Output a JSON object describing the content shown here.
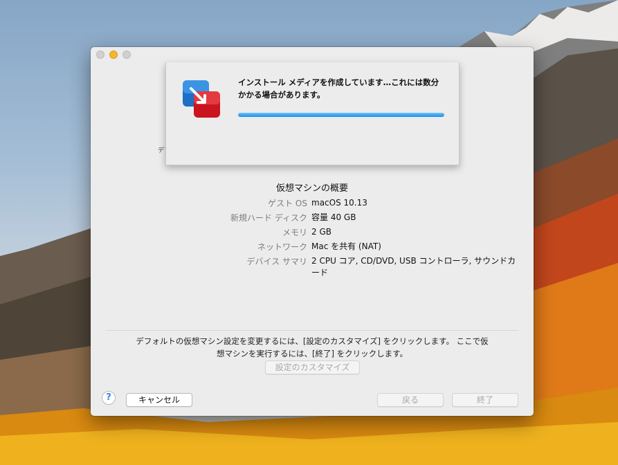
{
  "window": {
    "background_note": "",
    "ghost_label": "デフ"
  },
  "progress_sheet": {
    "message": "インストール メディアを作成しています…これには数分かかる場合があります。",
    "progress_fraction": 1.0,
    "accent_color": "#1e8ee8"
  },
  "summary": {
    "title": "仮想マシンの概要",
    "rows": [
      {
        "key": "ゲスト OS",
        "value": "macOS 10.13"
      },
      {
        "key": "新規ハード ディスク",
        "value": "容量 40 GB"
      },
      {
        "key": "メモリ",
        "value": "2 GB"
      },
      {
        "key": "ネットワーク",
        "value": "Mac を共有 (NAT)"
      },
      {
        "key": "デバイス サマリ",
        "value": "2 CPU コア, CD/DVD, USB コントローラ, サウンドカード"
      }
    ]
  },
  "note": {
    "line1": "デフォルトの仮想マシン設定を変更するには、[設定のカスタマイズ] をクリックします。 ここで仮",
    "line2": "想マシンを実行するには、[終了] をクリックします。"
  },
  "buttons": {
    "customize": "設定のカスタマイズ",
    "help": "?",
    "cancel": "キャンセル",
    "back": "戻る",
    "finish": "終了"
  },
  "icons": {
    "app": "vmware-fusion-icon",
    "help": "question-icon"
  }
}
